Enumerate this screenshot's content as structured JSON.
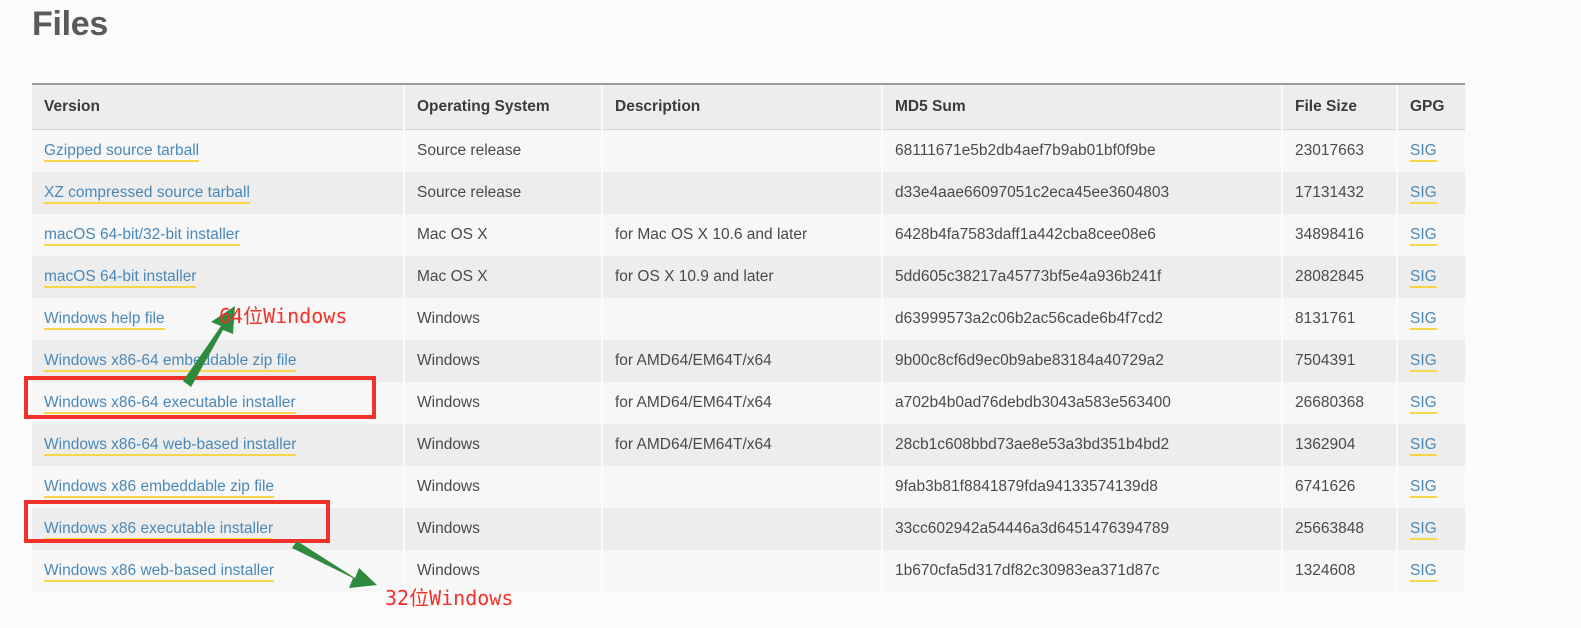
{
  "page": {
    "title": "Files"
  },
  "table": {
    "columns": [
      {
        "key": "version",
        "label": "Version"
      },
      {
        "key": "os",
        "label": "Operating System"
      },
      {
        "key": "description",
        "label": "Description"
      },
      {
        "key": "md5",
        "label": "MD5 Sum"
      },
      {
        "key": "size",
        "label": "File Size"
      },
      {
        "key": "gpg",
        "label": "GPG"
      }
    ],
    "rows": [
      {
        "version": "Gzipped source tarball",
        "os": "Source release",
        "description": "",
        "md5": "68111671e5b2db4aef7b9ab01bf0f9be",
        "size": "23017663",
        "gpg": "SIG"
      },
      {
        "version": "XZ compressed source tarball",
        "os": "Source release",
        "description": "",
        "md5": "d33e4aae66097051c2eca45ee3604803",
        "size": "17131432",
        "gpg": "SIG"
      },
      {
        "version": "macOS 64-bit/32-bit installer",
        "os": "Mac OS X",
        "description": "for Mac OS X 10.6 and later",
        "md5": "6428b4fa7583daff1a442cba8cee08e6",
        "size": "34898416",
        "gpg": "SIG"
      },
      {
        "version": "macOS 64-bit installer",
        "os": "Mac OS X",
        "description": "for OS X 10.9 and later",
        "md5": "5dd605c38217a45773bf5e4a936b241f",
        "size": "28082845",
        "gpg": "SIG"
      },
      {
        "version": "Windows help file",
        "os": "Windows",
        "description": "",
        "md5": "d63999573a2c06b2ac56cade6b4f7cd2",
        "size": "8131761",
        "gpg": "SIG"
      },
      {
        "version": "Windows x86-64 embeddable zip file",
        "os": "Windows",
        "description": "for AMD64/EM64T/x64",
        "md5": "9b00c8cf6d9ec0b9abe83184a40729a2",
        "size": "7504391",
        "gpg": "SIG"
      },
      {
        "version": "Windows x86-64 executable installer",
        "os": "Windows",
        "description": "for AMD64/EM64T/x64",
        "md5": "a702b4b0ad76debdb3043a583e563400",
        "size": "26680368",
        "gpg": "SIG"
      },
      {
        "version": "Windows x86-64 web-based installer",
        "os": "Windows",
        "description": "for AMD64/EM64T/x64",
        "md5": "28cb1c608bbd73ae8e53a3bd351b4bd2",
        "size": "1362904",
        "gpg": "SIG"
      },
      {
        "version": "Windows x86 embeddable zip file",
        "os": "Windows",
        "description": "",
        "md5": "9fab3b81f8841879fda94133574139d8",
        "size": "6741626",
        "gpg": "SIG"
      },
      {
        "version": "Windows x86 executable installer",
        "os": "Windows",
        "description": "",
        "md5": "33cc602942a54446a3d6451476394789",
        "size": "25663848",
        "gpg": "SIG"
      },
      {
        "version": "Windows x86 web-based installer",
        "os": "Windows",
        "description": "",
        "md5": "1b670cfa5d317df82c30983ea371d87c",
        "size": "1324608",
        "gpg": "SIG"
      }
    ]
  },
  "annotations": {
    "label_64bit": "64位Windows",
    "label_32bit": "32位Windows",
    "box_color": "#f0322b",
    "arrow_color": "#2e8b3d",
    "text_color": "#f0322b"
  },
  "colors": {
    "link": "#4b88b7",
    "link_underline": "#f7d64a",
    "header_bg": "#ededed",
    "row_odd_bg": "#f7f7f7",
    "row_even_bg": "#ededed",
    "page_bg": "#fbfbfb",
    "title": "#5a5a5a"
  }
}
